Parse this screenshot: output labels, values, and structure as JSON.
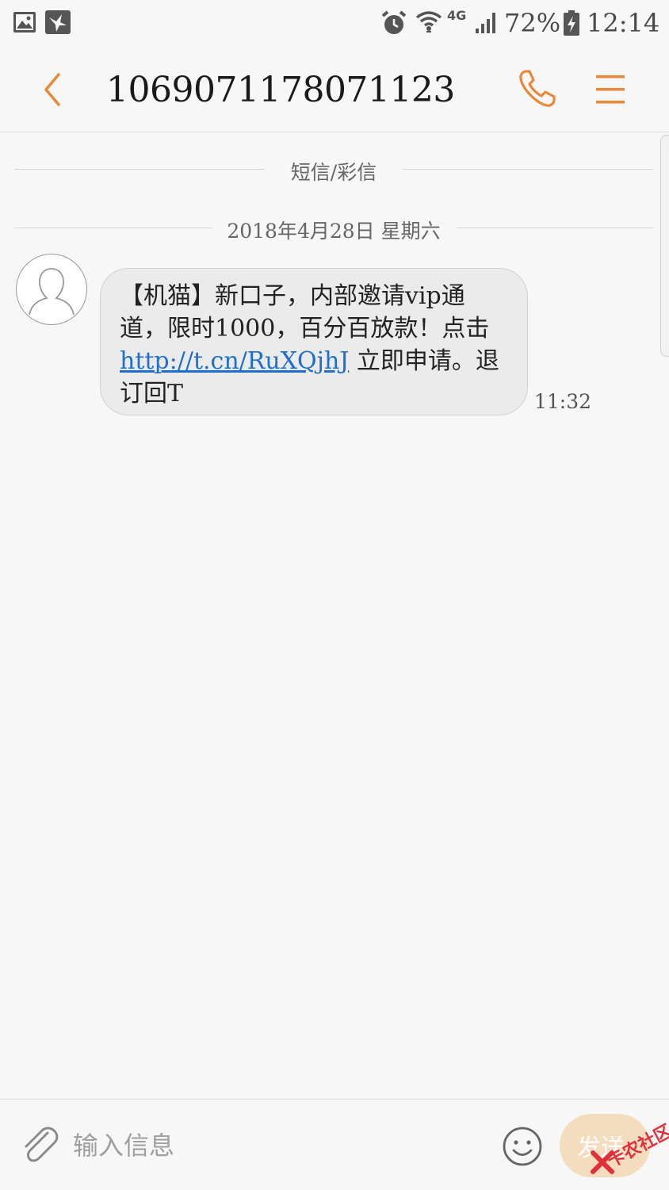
{
  "status_bar": {
    "battery": "72%",
    "network": "4G",
    "time": "12:14",
    "icons": [
      "gallery-icon",
      "pigeon-icon",
      "alarm-icon",
      "wifi-icon",
      "signal-icon",
      "battery-charging-icon"
    ]
  },
  "header": {
    "title": "1069071178071123",
    "accent_color": "#e8893a",
    "icons": [
      "back-arrow-icon",
      "phone-icon",
      "menu-icon"
    ]
  },
  "thread": {
    "type_label": "短信/彩信",
    "date_label": "2018年4月28日 星期六",
    "messages": [
      {
        "text_before": "【机猫】新口子，内部邀请vip通道，限时1000，百分百放款！点击 ",
        "link": "http://t.cn/RuXQjhJ",
        "text_after": " 立即申请。退订回T",
        "time": "11:32"
      }
    ]
  },
  "composer": {
    "placeholder": "输入信息",
    "send_label": "发送",
    "icons": [
      "paperclip-icon",
      "smiley-icon"
    ]
  },
  "watermark": {
    "text": "卡农社区"
  }
}
